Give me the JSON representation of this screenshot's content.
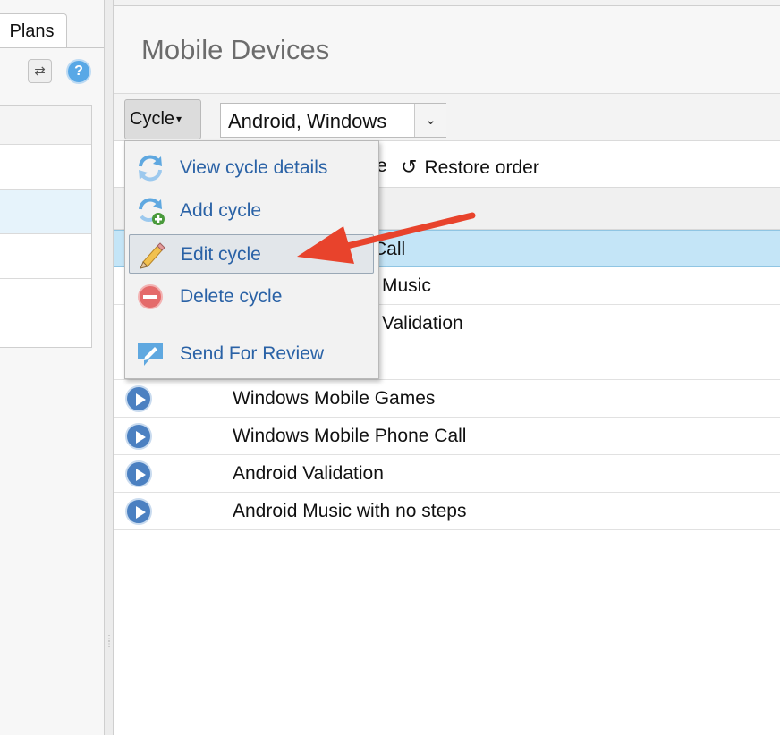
{
  "left_panel": {
    "tab_label": "Plans",
    "refresh_icon": "refresh-icon",
    "help_label": "?"
  },
  "header": {
    "title": "Mobile Devices"
  },
  "toolbar": {
    "cycle_button_label": "Cycle",
    "filter_value": "Android, Windows",
    "partial_action_text": "e",
    "restore_order_label": "Restore order"
  },
  "cycle_menu": {
    "items": [
      {
        "label": "View cycle details",
        "icon": "refresh-cycle-icon"
      },
      {
        "label": "Add cycle",
        "icon": "add-cycle-icon"
      },
      {
        "label": "Edit cycle",
        "icon": "pencil-icon"
      },
      {
        "label": "Delete cycle",
        "icon": "delete-icon"
      },
      {
        "label": "Send For Review",
        "icon": "send-review-icon"
      }
    ]
  },
  "grid": {
    "rows": [
      {
        "name": "Call",
        "selected": true
      },
      {
        "name": "Music"
      },
      {
        "name": "Validation"
      },
      {
        "name": ""
      },
      {
        "name": "Windows Mobile Games"
      },
      {
        "name": "Windows Mobile Phone Call"
      },
      {
        "name": "Android Validation"
      },
      {
        "name": "Android Music with no steps"
      }
    ]
  },
  "colors": {
    "menu_link": "#2a62a6",
    "selected_row": "#c4e5f7",
    "play_icon": "#4b80c1",
    "annotation_arrow": "#e8432c"
  }
}
